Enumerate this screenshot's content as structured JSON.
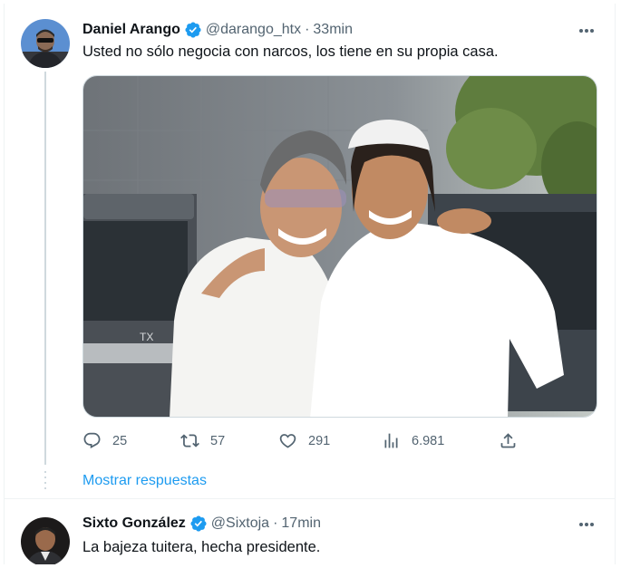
{
  "tweets": [
    {
      "author_name": "Daniel Arango",
      "handle": "@darango_htx",
      "separator": "·",
      "time": "33min",
      "text": "Usted no sólo negocia con narcos, los tiene en su propia casa.",
      "stats": {
        "replies": "25",
        "retweets": "57",
        "likes": "291",
        "views": "6.981"
      },
      "show_replies": "Mostrar respuestas"
    },
    {
      "author_name": "Sixto González",
      "handle": "@Sixtoja",
      "separator": "·",
      "time": "17min",
      "text": "La bajeza tuitera, hecha presidente."
    }
  ],
  "colors": {
    "accent": "#1d9bf0",
    "secondary_text": "#536471",
    "divider": "#eff3f4",
    "thread_line": "#cfd9de"
  },
  "icons": [
    "verified-badge-icon",
    "more-options-icon",
    "reply-icon",
    "retweet-icon",
    "like-icon",
    "views-icon",
    "share-icon"
  ]
}
